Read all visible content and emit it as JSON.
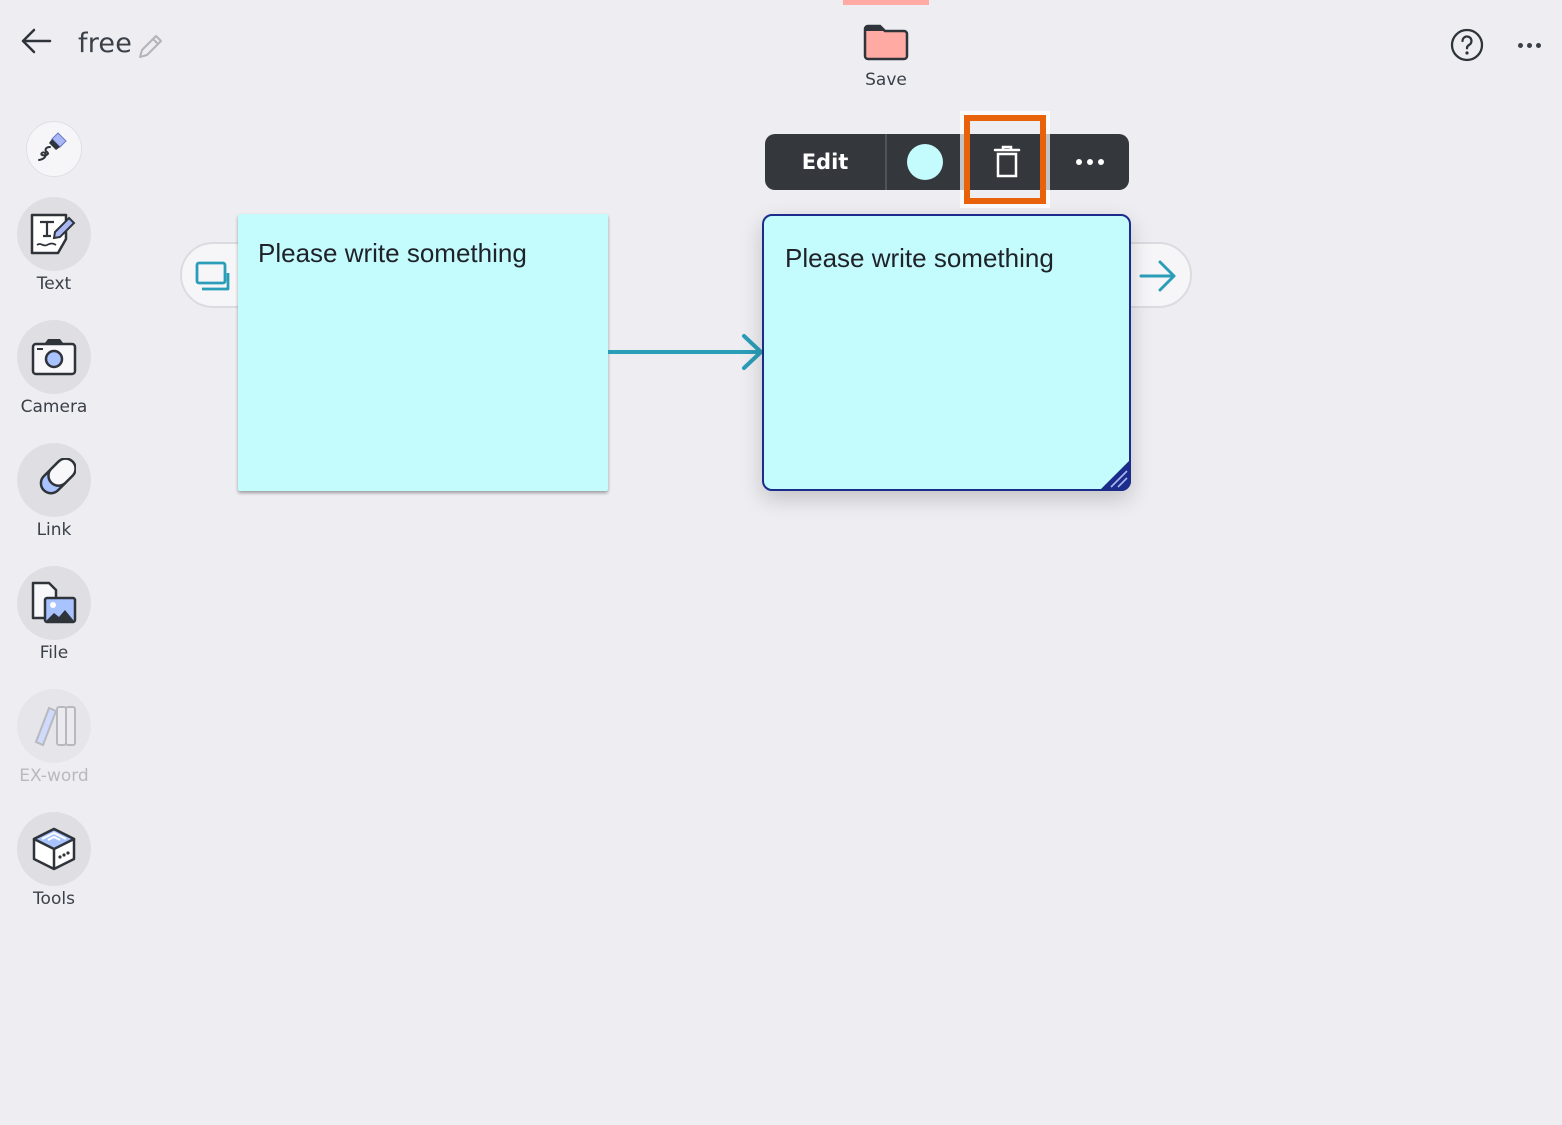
{
  "header": {
    "back_icon": "arrow-left-icon",
    "title": "free",
    "edit_title_icon": "pencil-icon",
    "save_label": "Save",
    "save_icon": "folder-icon",
    "save_color": "#ffaaa3",
    "help_icon": "question-circle-icon",
    "more_icon": "ellipsis-icon"
  },
  "sidebar": {
    "pen_tool": {
      "icon": "marker-pen-icon"
    },
    "items": [
      {
        "label": "Text",
        "icon": "text-card-icon",
        "enabled": true
      },
      {
        "label": "Camera",
        "icon": "camera-icon",
        "enabled": true
      },
      {
        "label": "Link",
        "icon": "link-icon",
        "enabled": true
      },
      {
        "label": "File",
        "icon": "file-image-icon",
        "enabled": true
      },
      {
        "label": "EX-word",
        "icon": "books-icon",
        "enabled": false
      },
      {
        "label": "Tools",
        "icon": "toolbox-icon",
        "enabled": true
      }
    ]
  },
  "canvas": {
    "notes": [
      {
        "text": "Please write something",
        "color": "#c4fbfd",
        "selected": false
      },
      {
        "text": "Please write something",
        "color": "#c4fbfd",
        "selected": true
      }
    ],
    "connector": {
      "from": 0,
      "to": 1,
      "color": "#2a9db8"
    },
    "left_pill_icon": "duplicate-card-icon",
    "right_pill_icon": "arrow-right-icon"
  },
  "context_toolbar": {
    "edit_label": "Edit",
    "color_value": "#c4fbfd",
    "delete_icon": "trash-icon",
    "more_icon": "ellipsis-icon",
    "highlighted": "delete",
    "highlight_color": "#e8620c"
  }
}
